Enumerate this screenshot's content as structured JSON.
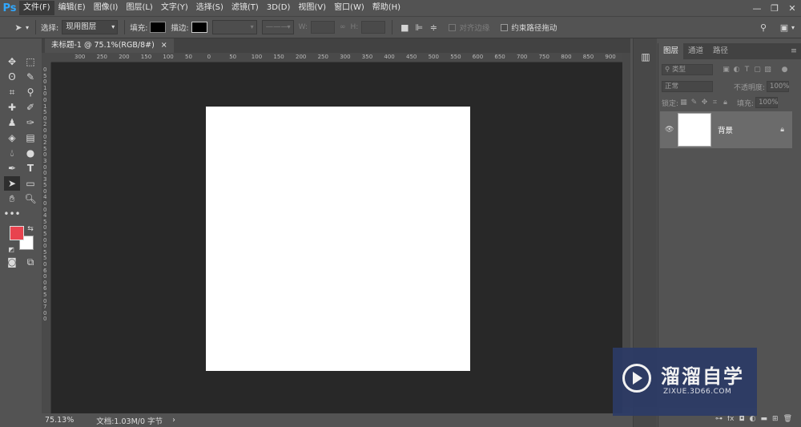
{
  "app": {
    "logo": "Ps"
  },
  "menu": [
    "文件(F)",
    "编辑(E)",
    "图像(I)",
    "图层(L)",
    "文字(Y)",
    "选择(S)",
    "滤镜(T)",
    "3D(D)",
    "视图(V)",
    "窗口(W)",
    "帮助(H)"
  ],
  "window_controls": {
    "minimize": "—",
    "restore": "❐",
    "close": "✕"
  },
  "options": {
    "select_label": "选择:",
    "select_value": "现用图层",
    "fill_label": "填充:",
    "stroke_label": "描边:",
    "w_label": "W:",
    "h_label": "H:",
    "align_edges_label": "对齐边缘",
    "constrain_path_label": "约束路径拖动"
  },
  "document": {
    "tab_title": "未标题-1 @ 75.1%(RGB/8#)",
    "tab_close": "×",
    "canvas_color": "#ffffff"
  },
  "ruler": {
    "top_ticks": [
      "300",
      "250",
      "200",
      "150",
      "100",
      "50",
      "0",
      "50",
      "100",
      "150",
      "200",
      "250",
      "300",
      "350",
      "400",
      "450",
      "500",
      "550",
      "600",
      "650",
      "700",
      "750",
      "800",
      "850",
      "900"
    ],
    "left_text": "050100150200250300350400450500550600650700"
  },
  "colors": {
    "foreground": "#e8434f",
    "background": "#ffffff",
    "watermark_bg": "#2c3b66"
  },
  "status": {
    "zoom": "75.13%",
    "doc_info": "文档:1.03M/0 字节",
    "arrow": "›"
  },
  "panel": {
    "tabs": [
      "图层",
      "通道",
      "路径"
    ],
    "filter_kind": "类型",
    "blend_mode": "正常",
    "opacity_label": "不透明度:",
    "opacity_value": "100%",
    "lock_label": "锁定:",
    "fill_label": "填充:",
    "fill_value": "100%",
    "layer_name": "背景"
  },
  "watermark": {
    "title": "溜溜自学",
    "url": "ZIXUE.3D66.COM"
  }
}
